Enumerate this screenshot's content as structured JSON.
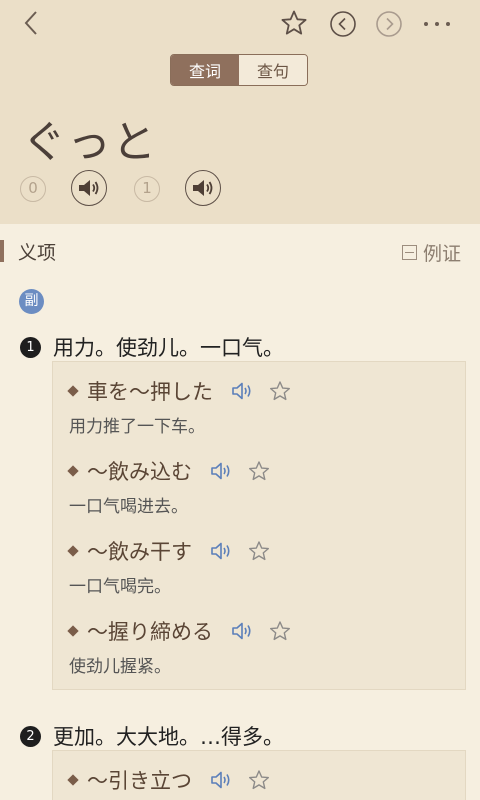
{
  "header": {
    "tabs": [
      "查词",
      "查句"
    ],
    "word": "ぐっと",
    "pronunciations": [
      {
        "num": "0"
      },
      {
        "num": "1"
      }
    ]
  },
  "section": {
    "title": "义项",
    "example_toggle": "例证"
  },
  "pos": "副",
  "senses": [
    {
      "num": "1",
      "definition": "用力。使劲儿。一口气。",
      "examples": [
        {
          "jp": "車を～押した",
          "cn": "用力推了一下车。"
        },
        {
          "jp": "～飲み込む",
          "cn": "一口气喝进去。"
        },
        {
          "jp": "～飲み干す",
          "cn": "一口气喝完。"
        },
        {
          "jp": "～握り締める",
          "cn": "使劲儿握紧。"
        }
      ]
    },
    {
      "num": "2",
      "definition": "更加。大大地。…得多。",
      "examples": [
        {
          "jp": "～引き立つ",
          "cn": ""
        }
      ]
    }
  ],
  "colors": {
    "header_bg": "#ebdfc8",
    "body_bg": "#f6efe0",
    "accent": "#8f705d",
    "speaker_blue": "#5b7fba",
    "pos_badge": "#6c8dc2"
  }
}
